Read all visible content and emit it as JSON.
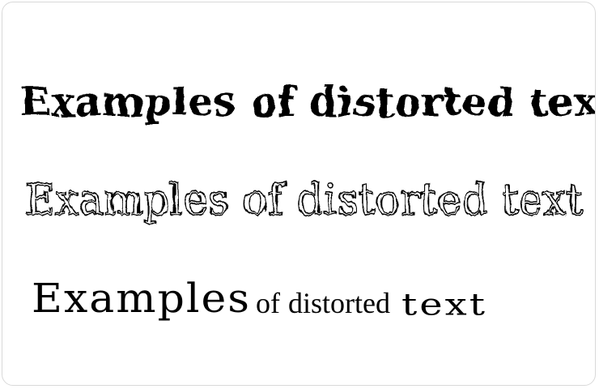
{
  "samples": [
    {
      "text": "Examples of distorted text",
      "style": "wavy-bold"
    },
    {
      "text": "Examples of distorted text",
      "style": "outlined-fragmented"
    },
    {
      "words": [
        "Examples",
        "of",
        "distorted",
        "text"
      ],
      "style": "varying-size"
    }
  ],
  "colors": {
    "background": "#ffffff",
    "border": "#d9d9d9",
    "text": "#000000"
  }
}
